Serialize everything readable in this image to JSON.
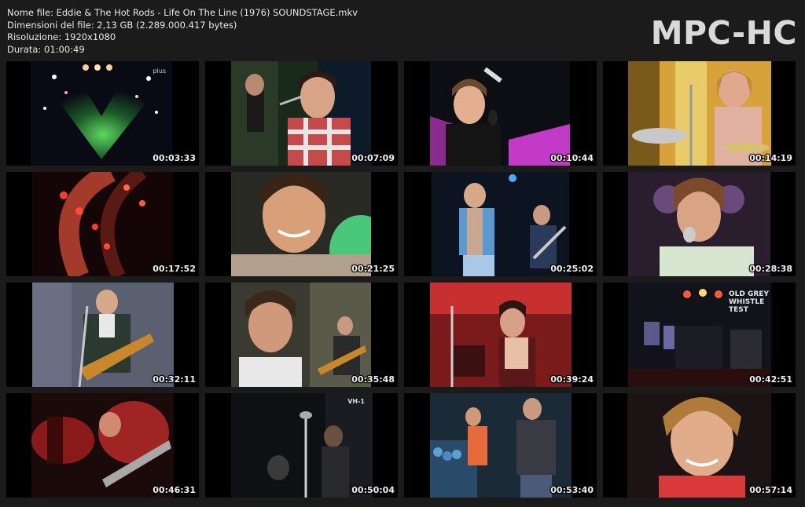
{
  "info": {
    "filename": "Nome file: Eddie & The Hot Rods - Life On The Line (1976) SOUNDSTAGE.mkv",
    "filesize": "Dimensioni del file: 2,13 GB (2.289.000.417 bytes)",
    "resolution": "Risoluzione: 1920x1080",
    "duration": "Durata: 01:00:49"
  },
  "brand": "MPC-HC",
  "thumbnails": [
    {
      "time": "00:03:33",
      "scene": "sparkling-lights-logo",
      "overlay": "plus"
    },
    {
      "time": "00:07:09",
      "scene": "singer-at-microphone"
    },
    {
      "time": "00:10:44",
      "scene": "singer-with-microphone"
    },
    {
      "time": "00:14:19",
      "scene": "drummer-behind-kit"
    },
    {
      "time": "00:17:52",
      "scene": "stage-lights-arc"
    },
    {
      "time": "00:21:25",
      "scene": "singer-close-up"
    },
    {
      "time": "00:25:02",
      "scene": "band-on-stage"
    },
    {
      "time": "00:28:38",
      "scene": "singer-close-up-microphone"
    },
    {
      "time": "00:32:11",
      "scene": "guitarist-street"
    },
    {
      "time": "00:35:48",
      "scene": "singer-and-guitarist-street"
    },
    {
      "time": "00:39:24",
      "scene": "singer-red-stage"
    },
    {
      "time": "00:42:51",
      "scene": "stage-wide-shot",
      "overlay": "OLD GREY WHISTLE TEST"
    },
    {
      "time": "00:46:31",
      "scene": "guitarist-red-blur"
    },
    {
      "time": "00:50:04",
      "scene": "dark-stage-microphone",
      "overlay": "VH-1"
    },
    {
      "time": "00:53:40",
      "scene": "band-playing-crowd"
    },
    {
      "time": "00:57:14",
      "scene": "singer-close-up-smile"
    }
  ]
}
